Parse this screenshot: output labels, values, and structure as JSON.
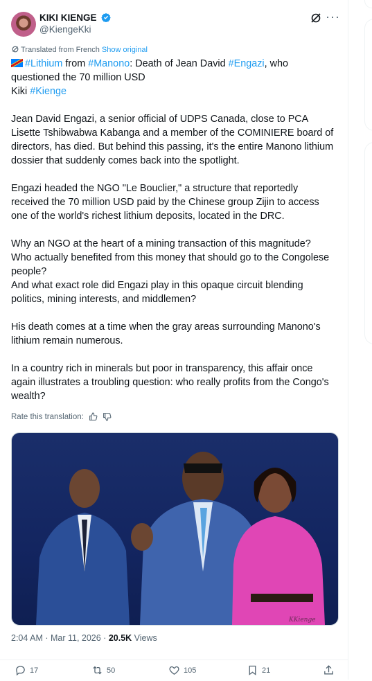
{
  "author": {
    "name": "KIKI KIENGE",
    "handle": "@KiengeKki"
  },
  "translation": {
    "note": "Translated from French",
    "show_original": "Show original",
    "rate_label": "Rate this translation:"
  },
  "tweet": {
    "h1": "#Lithium",
    "t1": " from ",
    "h2": "#Manono",
    "t2": ": Death of Jean David ",
    "h3": "#Engazi",
    "t3": ", who questioned the 70 million USD",
    "t4": "Kiki ",
    "h4": "#Kienge",
    "p2": "Jean David Engazi, a senior official of UDPS Canada, close to PCA Lisette Tshibwabwa Kabanga and a member of the COMINIERE board of directors, has died. But behind this passing, it's the entire Manono lithium dossier that suddenly comes back into the spotlight.",
    "p3": "Engazi headed the NGO \"Le Bouclier,\" a structure that reportedly received the 70 million USD paid by the Chinese group Zijin to access one of the world's richest lithium deposits, located in the DRC.",
    "p4": "Why an NGO at the heart of a mining transaction of this magnitude?\nWho actually benefited from this money that should go to the Congolese people?\nAnd what exact role did Engazi play in this opaque circuit blending politics, mining interests, and middlemen?",
    "p5": "His death comes at a time when the gray areas surrounding Manono's lithium remain numerous.",
    "p6": "In a country rich in minerals but poor in transparency, this affair once again illustrates a troubling question: who really profits from the Congo's wealth?"
  },
  "media": {
    "watermark": "KKienge"
  },
  "meta": {
    "time": "2:04 AM · Mar 11, 2026 · ",
    "views_count": "20.5K",
    "views_label": " Views"
  },
  "actions": {
    "replies": "17",
    "reposts": "50",
    "likes": "105",
    "bookmarks": "21"
  },
  "colors": {
    "accent": "#1d9bf0",
    "text": "#0f1419",
    "muted": "#536471"
  }
}
